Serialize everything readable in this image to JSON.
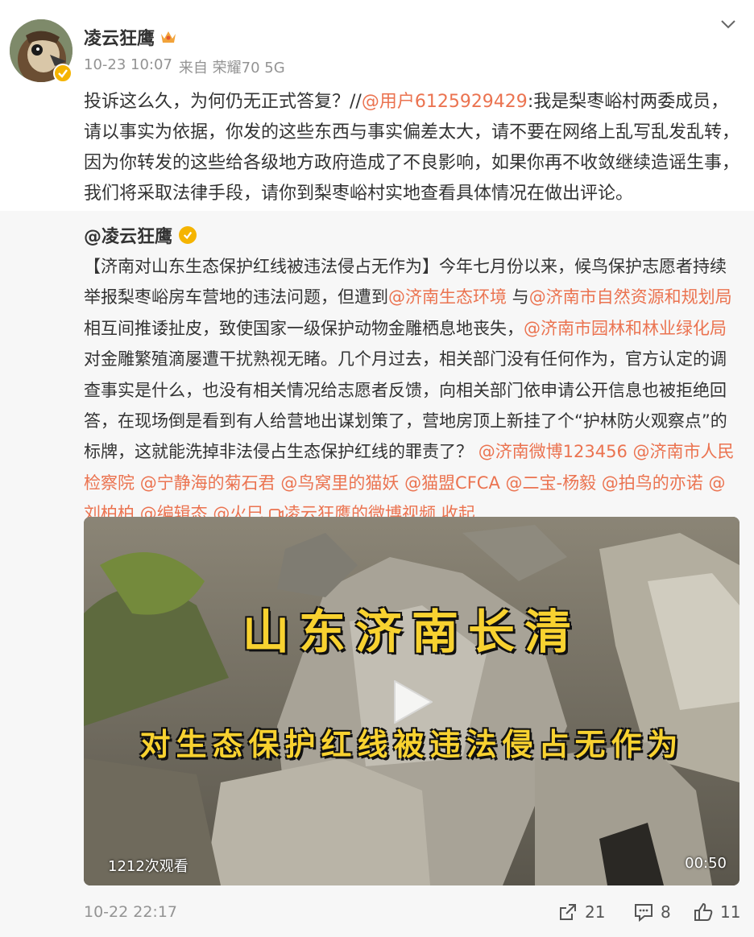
{
  "post": {
    "author": "凌云狂鹰",
    "timestamp": "10-23 10:07",
    "source": "来自 荣耀70 5G",
    "text_before": "投诉这么久，为何仍无正式答复？//",
    "text_mention": "@用户6125929429",
    "text_after": ":我是梨枣峪村两委成员，请以事实为依据，你发的这些东西与事实偏差太大，请不要在网络上乱写乱发乱转，因为你转发的这些给各级地方政府造成了不良影响，如果你再不收敛继续造谣生事，我们将采取法律手段，请你到梨枣峪村实地查看具体情况在做出评论。"
  },
  "original": {
    "author": "@凌云狂鹰",
    "segments": {
      "s1": "【济南对山东生态保护红线被违法侵占无作为】今年七月份以来，候鸟保护志愿者持续举报梨枣峪房车营地的违法问题，但遭到",
      "m1": "@济南生态环境",
      "s2": " 与",
      "m2": "@济南市自然资源和规划局",
      "s3": " 相互间推诿扯皮，致使国家一级保护动物金雕栖息地丧失，",
      "m3": "@济南市园林和林业绿化局",
      "s4": " 对金雕繁殖滴屡遭干扰熟视无睹。几个月过去，相关部门没有任何作为，官方认定的调查事实是什么，也没有相关情况给志愿者反馈，向相关部门依申请公开信息也被拒绝回答，在现场倒是看到有人给营地出谋划策了，营地房顶上新挂了个“护林防火观察点”的标牌，这就能洗掉非法侵占生态保护红线的罪责了？",
      "m4": "@济南微博123456",
      "m5": "@济南市人民检察院",
      "m6": "@宁静海的菊石君",
      "m7": "@鸟窝里的猫妖",
      "m8": "@猫盟CFCA",
      "m9": "@二宝-杨毅",
      "m10": "@拍鸟的亦诺",
      "m11": "@刘柏柏",
      "m12": "@编辑态",
      "m13": "@火巳",
      "video_link": "凌云狂鹰的微博视频",
      "collapse": "收起"
    },
    "video": {
      "title_main": "山东济南长清",
      "title_sub": "对生态保护红线被违法侵占无作为",
      "views": "1212次观看",
      "duration": "00:50"
    },
    "time": "10-22 22:17",
    "reposts": "21",
    "comments": "8",
    "likes": "11"
  },
  "colors": {
    "mention": "#eb7350",
    "meta": "#939393",
    "repost_bg": "#f7f7f7",
    "verify": "#f5b400",
    "video_title": "#f8d230"
  },
  "icons": [
    "avatar-eagle",
    "verified-icon",
    "crown-icon",
    "chevron-down-icon",
    "play-icon",
    "video-link-icon",
    "repost-icon",
    "comment-icon",
    "like-icon"
  ]
}
